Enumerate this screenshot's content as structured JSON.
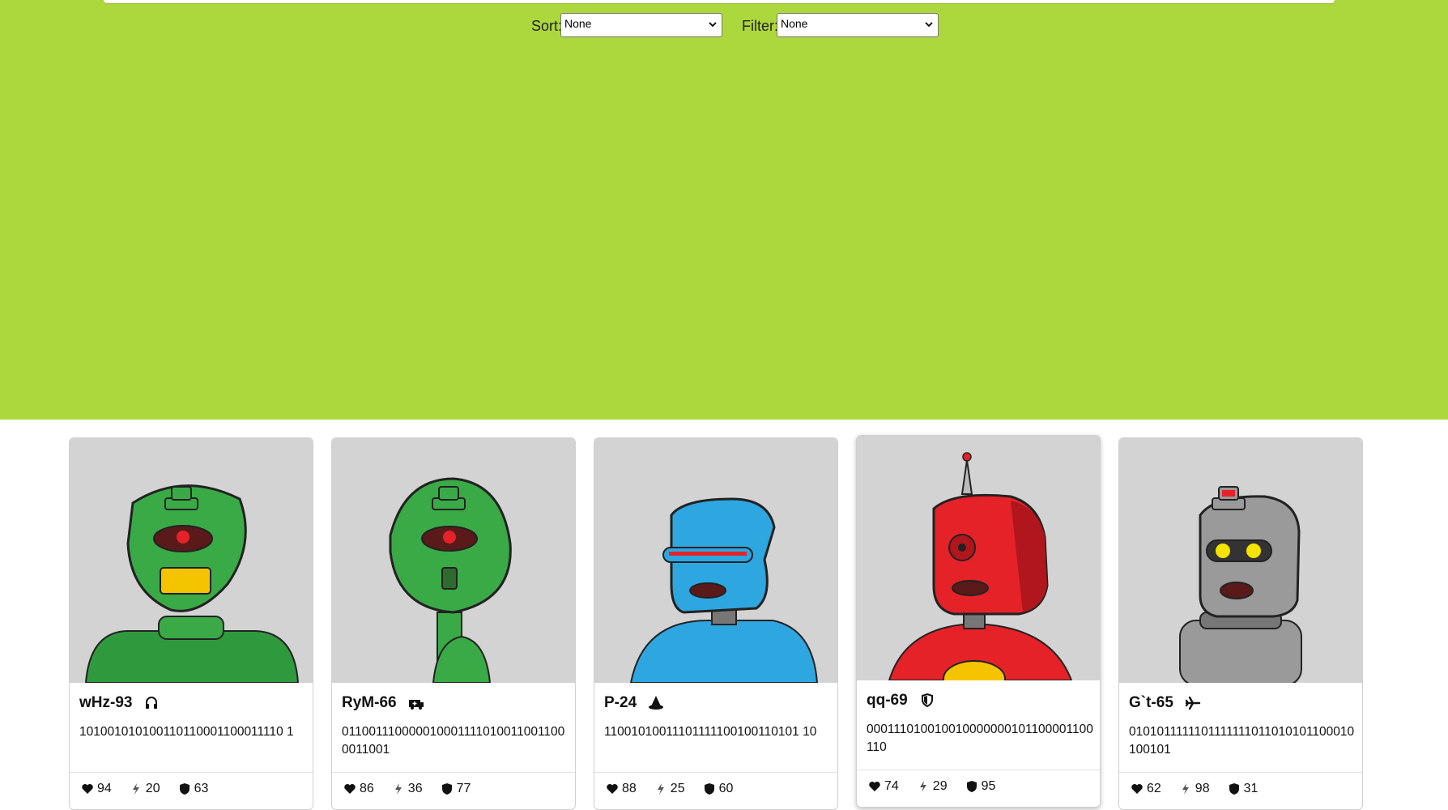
{
  "controls": {
    "sort_label": "Sort:",
    "sort_value": "None",
    "filter_label": "Filter:",
    "filter_value": "None"
  },
  "colors": {
    "hero_background": "#add83d",
    "card_portrait_background": "#d3d3d3"
  },
  "cards": [
    {
      "name": "wHz-93",
      "role_icon": "headset-icon",
      "bits": "101001010100110110001100011110 1",
      "robot_color": "#3aaa47",
      "health": "94",
      "energy": "20",
      "defense": "63"
    },
    {
      "name": "RyM-66",
      "role_icon": "ambulance-icon",
      "bits": "0110011100000100011110100110011000011001",
      "robot_color": "#3aaa47",
      "health": "86",
      "energy": "36",
      "defense": "77"
    },
    {
      "name": "P-24",
      "role_icon": "wizard-hat-icon",
      "bits": "11001010011101111100100110101 10",
      "robot_color": "#2ea6e0",
      "health": "88",
      "energy": "25",
      "defense": "60"
    },
    {
      "name": "qq-69",
      "role_icon": "shield-icon",
      "bits": "000111010010010000000101100001100110",
      "robot_color": "#e52228",
      "health": "74",
      "energy": "29",
      "defense": "95"
    },
    {
      "name": "G`t-65",
      "role_icon": "airplane-icon",
      "bits": "0101011111101111111011010101100010100101",
      "robot_color": "#9a9a9a",
      "health": "62",
      "energy": "98",
      "defense": "31"
    }
  ]
}
